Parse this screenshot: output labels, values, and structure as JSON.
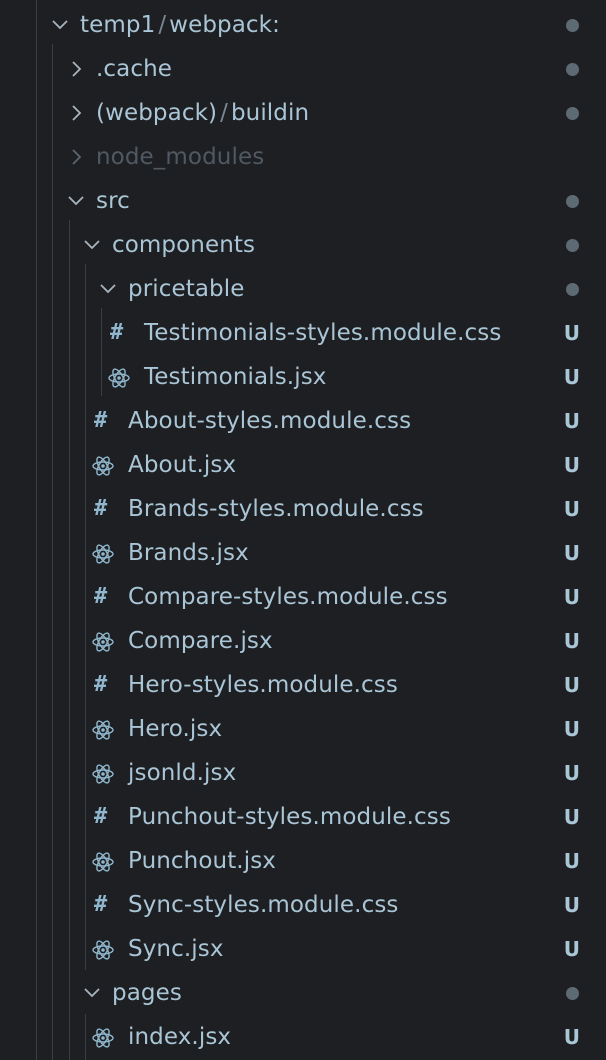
{
  "tree": {
    "root": {
      "label_a": "temp1",
      "sep": "/",
      "label_b": "webpack:",
      "status": "dot"
    },
    "items": [
      {
        "label": ".cache",
        "type": "folder-collapsed",
        "status": "dot"
      },
      {
        "label_a": "(webpack)",
        "sep": "/",
        "label_b": "buildin",
        "type": "folder-collapsed",
        "status": "dot"
      },
      {
        "label": "node_modules",
        "type": "folder-collapsed-dim",
        "status": ""
      },
      {
        "label": "src",
        "type": "folder-expanded",
        "status": "dot"
      },
      {
        "label": "components",
        "type": "folder-expanded",
        "status": "dot"
      },
      {
        "label": "pricetable",
        "type": "folder-expanded",
        "status": "dot"
      },
      {
        "label": "Testimonials-styles.module.css",
        "type": "css",
        "status": "U"
      },
      {
        "label": "Testimonials.jsx",
        "type": "jsx",
        "status": "U"
      },
      {
        "label": "About-styles.module.css",
        "type": "css",
        "status": "U"
      },
      {
        "label": "About.jsx",
        "type": "jsx",
        "status": "U"
      },
      {
        "label": "Brands-styles.module.css",
        "type": "css",
        "status": "U"
      },
      {
        "label": "Brands.jsx",
        "type": "jsx",
        "status": "U"
      },
      {
        "label": "Compare-styles.module.css",
        "type": "css",
        "status": "U"
      },
      {
        "label": "Compare.jsx",
        "type": "jsx",
        "status": "U"
      },
      {
        "label": "Hero-styles.module.css",
        "type": "css",
        "status": "U"
      },
      {
        "label": "Hero.jsx",
        "type": "jsx",
        "status": "U"
      },
      {
        "label": "jsonld.jsx",
        "type": "jsx",
        "status": "U"
      },
      {
        "label": "Punchout-styles.module.css",
        "type": "css",
        "status": "U"
      },
      {
        "label": "Punchout.jsx",
        "type": "jsx",
        "status": "U"
      },
      {
        "label": "Sync-styles.module.css",
        "type": "css",
        "status": "U"
      },
      {
        "label": "Sync.jsx",
        "type": "jsx",
        "status": "U"
      },
      {
        "label": "pages",
        "type": "folder-expanded",
        "status": "dot"
      },
      {
        "label": "index.jsx",
        "type": "jsx",
        "status": "U"
      }
    ]
  },
  "colors": {
    "background": "#1e1f22",
    "text": "#a9c5d6",
    "dim_text": "#4f5963",
    "status_dot": "#5d6a74",
    "guide": "#3a3e44"
  }
}
